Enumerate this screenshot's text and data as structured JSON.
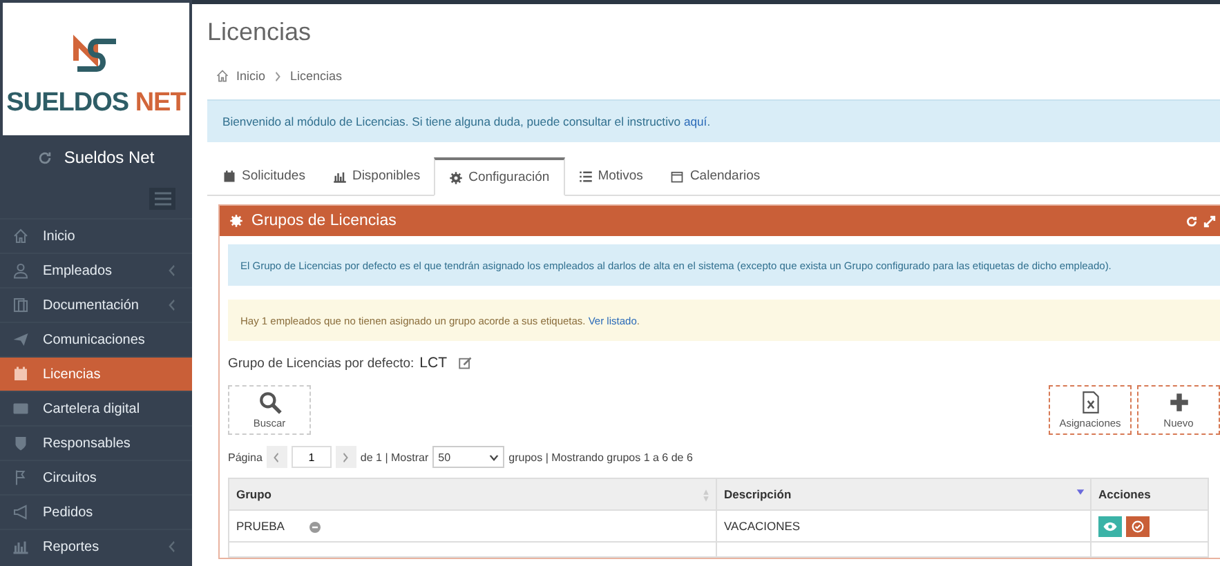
{
  "sidebar": {
    "logo": {
      "top": "SUELDOS",
      "accent": "NET"
    },
    "brand": "Sueldos Net",
    "items": [
      {
        "label": "Inicio",
        "selected": false,
        "has_submenu": false
      },
      {
        "label": "Empleados",
        "selected": false,
        "has_submenu": true
      },
      {
        "label": "Documentación",
        "selected": false,
        "has_submenu": true
      },
      {
        "label": "Comunicaciones",
        "selected": false,
        "has_submenu": false
      },
      {
        "label": "Licencias",
        "selected": true,
        "has_submenu": false
      },
      {
        "label": "Cartelera digital",
        "selected": false,
        "has_submenu": false
      },
      {
        "label": "Responsables",
        "selected": false,
        "has_submenu": false
      },
      {
        "label": "Circuitos",
        "selected": false,
        "has_submenu": false
      },
      {
        "label": "Pedidos",
        "selected": false,
        "has_submenu": false
      },
      {
        "label": "Reportes",
        "selected": false,
        "has_submenu": true
      }
    ]
  },
  "page_title": "Licencias",
  "breadcrumb": [
    "Inicio",
    "Licencias"
  ],
  "welcome": {
    "text": "Bienvenido al módulo de Licencias. Si tiene alguna duda, puede consultar el instructivo ",
    "link": "aquí",
    "end": "."
  },
  "tabs": [
    {
      "label": "Solicitudes",
      "selected": false
    },
    {
      "label": "Disponibles",
      "selected": false
    },
    {
      "label": "Configuración",
      "selected": true
    },
    {
      "label": "Motivos",
      "selected": false
    },
    {
      "label": "Calendarios",
      "selected": false
    }
  ],
  "panel": {
    "title": "Grupos de Licencias",
    "info": "El Grupo de Licencias por defecto es el que tendrán asignado los empleados al darlos de alta en el sistema (excepto que exista un Grupo configurado para las etiquetas de dicho empleado).",
    "warning": {
      "text": "Hay 1 empleados que no tienen asignado un grupo acorde a sus etiquetas. ",
      "link": "Ver listado",
      "end": "."
    },
    "default_group": {
      "label": "Grupo de Licencias por defecto:",
      "value": "LCT"
    },
    "toolbar_left": [
      {
        "label": "Buscar"
      }
    ],
    "toolbar_right": [
      {
        "label": "Asignaciones"
      },
      {
        "label": "Nuevo"
      }
    ],
    "pager": {
      "page_label": "Página",
      "page": "1",
      "of": "de 1 | Mostrar",
      "per_page": "50",
      "summary": "grupos | Mostrando grupos 1 a 6 de 6"
    },
    "table": {
      "columns": [
        {
          "label": "Grupo",
          "kind": "sortable"
        },
        {
          "label": "Descripción",
          "kind": "sorted"
        },
        {
          "label": "Acciones",
          "kind": "plain"
        }
      ],
      "rows": [
        {
          "grupo": "PRUEBA",
          "descripcion": "VACACIONES",
          "actions": [
            {
              "kind": "view"
            },
            {
              "kind": "check"
            }
          ]
        }
      ]
    }
  }
}
